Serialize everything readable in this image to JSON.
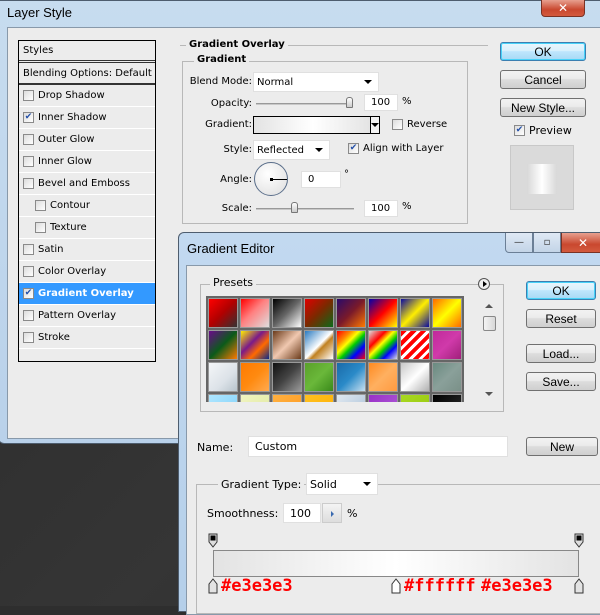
{
  "layer_style": {
    "title": "Layer Style",
    "styles_header": "Styles",
    "blending_options": "Blending Options: Default",
    "effects": [
      {
        "label": "Drop Shadow",
        "checked": false,
        "sub": false,
        "selected": false
      },
      {
        "label": "Inner Shadow",
        "checked": true,
        "sub": false,
        "selected": false
      },
      {
        "label": "Outer Glow",
        "checked": false,
        "sub": false,
        "selected": false
      },
      {
        "label": "Inner Glow",
        "checked": false,
        "sub": false,
        "selected": false
      },
      {
        "label": "Bevel and Emboss",
        "checked": false,
        "sub": false,
        "selected": false
      },
      {
        "label": "Contour",
        "checked": false,
        "sub": true,
        "selected": false
      },
      {
        "label": "Texture",
        "checked": false,
        "sub": true,
        "selected": false
      },
      {
        "label": "Satin",
        "checked": false,
        "sub": false,
        "selected": false
      },
      {
        "label": "Color Overlay",
        "checked": false,
        "sub": false,
        "selected": false
      },
      {
        "label": "Gradient Overlay",
        "checked": true,
        "sub": false,
        "selected": true
      },
      {
        "label": "Pattern Overlay",
        "checked": false,
        "sub": false,
        "selected": false
      },
      {
        "label": "Stroke",
        "checked": false,
        "sub": false,
        "selected": false
      }
    ],
    "section_title": "Gradient Overlay",
    "group_title": "Gradient",
    "blend_mode_label": "Blend Mode:",
    "blend_mode_value": "Normal",
    "opacity_label": "Opacity:",
    "opacity_value": "100",
    "opacity_percent": 100,
    "percent_sign": "%",
    "gradient_label": "Gradient:",
    "reverse_label": "Reverse",
    "reverse_checked": false,
    "style_label": "Style:",
    "style_value": "Reflected",
    "align_label": "Align with Layer",
    "align_checked": true,
    "angle_label": "Angle:",
    "angle_value": "0",
    "degree_sign": "°",
    "scale_label": "Scale:",
    "scale_value": "100",
    "scale_slider_fraction": 0.4,
    "buttons": {
      "ok": "OK",
      "cancel": "Cancel",
      "new_style": "New Style..."
    },
    "preview_label": "Preview",
    "preview_checked": true,
    "close_glyph": "✕"
  },
  "gradient_editor": {
    "title": "Gradient Editor",
    "presets_label": "Presets",
    "buttons": {
      "ok": "OK",
      "reset": "Reset",
      "load": "Load...",
      "save": "Save...",
      "new": "New"
    },
    "name_label": "Name:",
    "name_value": "Custom",
    "gradient_type_label": "Gradient Type:",
    "gradient_type_value": "Solid",
    "smoothness_label": "Smoothness:",
    "smoothness_value": "100",
    "percent_sign": "%",
    "window_controls": {
      "minimize": "—",
      "maximize": "▫",
      "close": "✕"
    },
    "presets": [
      "linear-gradient(135deg,#ff0000 0%,#b00000 50%,#333 100%)",
      "linear-gradient(135deg,#ff0000 0%,#ff8080 45%,#ddd 100%)",
      "linear-gradient(135deg,#000 0%,#666 50%,#fff 100%)",
      "linear-gradient(135deg,#e00000 0%,#7a2a00 50%,#0b6a1a 100%)",
      "linear-gradient(135deg,#2a0a6a 0%,#7a1a2a 50%,#ff7a00 100%)",
      "linear-gradient(135deg,#0000aa 0%,#ff0000 50%,#ffff00 100%)",
      "linear-gradient(135deg,#0a0aa0 0%,#ffee00 50%,#0a0aa0 100%)",
      "linear-gradient(135deg,#ff6a00 0%,#ffff00 50%,#ff6a00 100%)",
      "linear-gradient(135deg,#6a0a8a 0%,#0b5a1a 50%,#ff7a00 100%)",
      "linear-gradient(135deg,#ffee00 0%,#7a1a8a 40%,#ff6a00 65%,#0a2a8a 100%)",
      "linear-gradient(135deg,#6a3a1a 0%,#f0c8b0 50%,#6a3a1a 100%)",
      "linear-gradient(135deg,#2a7ac0 0%,#ffffff 50%,#c08020 60%,#ffffff 100%)",
      "linear-gradient(135deg,#ff0000 0%,#ff8800 25%,#ffff00 40%,#00cc00 55%,#0000ff 75%,#ff0000 100%)",
      "linear-gradient(135deg,#ddd 0%,#ff0000 30%,#ffff00 45%,#00cc00 60%,#0000ff 75%,#ddd 100%)",
      "repeating-linear-gradient(135deg,#ff0000 0px,#ff0000 4px,#ffffff 4px,#ffffff 7px)",
      "linear-gradient(135deg,#c02a9a 0%,#d03aaa 50%,#a0207a 100%)",
      "linear-gradient(135deg,#f4f6f8 0%,#dce2e8 60%,#b8c4cc 100%)",
      "linear-gradient(135deg,#ff7a00 0%,#ff8a10 50%,#ffaa50 100%)",
      "linear-gradient(135deg,#111 0%,#444 50%,#999 100%)",
      "linear-gradient(135deg,#5aa02a 0%,#6ab83a 50%,#3a8a1a 100%)",
      "linear-gradient(135deg,#1a6aa8 0%,#2a8ac8 50%,#c8e0f0 100%)",
      "linear-gradient(135deg,#ff8a20 0%,#ffb060 50%,#ff9a40 100%)",
      "linear-gradient(135deg,#c8c8c8 0%,#ffffff 50%,#b0b0b0 100%)",
      "linear-gradient(135deg,#6a8a80 0%,#8aa09a 50%,#7a9088 100%)",
      "linear-gradient(135deg,#aee6ff 0%,#80d0f8 100%)",
      "linear-gradient(135deg,#f0f4c0 0%,#e0e8a0 100%)",
      "linear-gradient(135deg,#ffb040 0%,#ff9a20 100%)",
      "linear-gradient(135deg,#ffc020 0%,#ffb000 100%)",
      "linear-gradient(135deg,#e0e8f0 0%,#a8c0d8 100%)",
      "linear-gradient(135deg,#9a30c8 0%,#b060d8 100%)",
      "linear-gradient(135deg,#a8d820 0%,#98c810 100%)",
      "linear-gradient(135deg,#000 0%,#333 100%)"
    ],
    "gradient_stops": [
      {
        "position": 0,
        "color": "#e3e3e3",
        "label": "#e3e3e3"
      },
      {
        "position": 50,
        "color": "#ffffff",
        "label": "#ffffff"
      },
      {
        "position": 100,
        "color": "#e3e3e3",
        "label": "#e3e3e3"
      }
    ],
    "opacity_stops": [
      {
        "position": 0,
        "opacity": 100
      },
      {
        "position": 100,
        "opacity": 100
      }
    ]
  }
}
